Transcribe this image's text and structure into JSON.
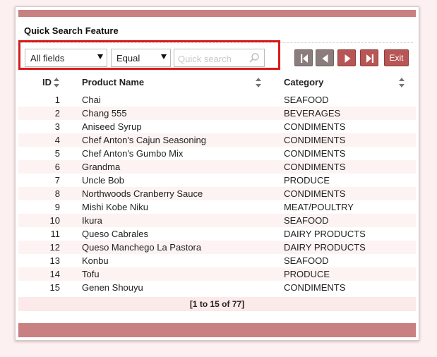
{
  "panel": {
    "title": "Quick Search Feature"
  },
  "search": {
    "field_select": "All fields",
    "operator_select": "Equal",
    "placeholder": "Quick search"
  },
  "nav": {
    "exit_label": "Exit"
  },
  "table": {
    "headers": {
      "id": "ID",
      "name": "Product Name",
      "category": "Category"
    },
    "rows": [
      {
        "id": "1",
        "name": "Chai",
        "category": "SEAFOOD"
      },
      {
        "id": "2",
        "name": "Chang 555",
        "category": "BEVERAGES"
      },
      {
        "id": "3",
        "name": "Aniseed Syrup",
        "category": "CONDIMENTS"
      },
      {
        "id": "4",
        "name": "Chef Anton's Cajun Seasoning",
        "category": "CONDIMENTS"
      },
      {
        "id": "5",
        "name": "Chef Anton's Gumbo Mix",
        "category": "CONDIMENTS"
      },
      {
        "id": "6",
        "name": "Grandma",
        "category": "CONDIMENTS"
      },
      {
        "id": "7",
        "name": "Uncle Bob",
        "category": "PRODUCE"
      },
      {
        "id": "8",
        "name": "Northwoods Cranberry Sauce",
        "category": "CONDIMENTS"
      },
      {
        "id": "9",
        "name": "Mishi Kobe Niku",
        "category": "MEAT/POULTRY"
      },
      {
        "id": "10",
        "name": "Ikura",
        "category": "SEAFOOD"
      },
      {
        "id": "11",
        "name": "Queso Cabrales",
        "category": "DAIRY PRODUCTS"
      },
      {
        "id": "12",
        "name": "Queso Manchego La Pastora",
        "category": "DAIRY PRODUCTS"
      },
      {
        "id": "13",
        "name": "Konbu",
        "category": "SEAFOOD"
      },
      {
        "id": "14",
        "name": "Tofu",
        "category": "PRODUCE"
      },
      {
        "id": "15",
        "name": "Genen Shouyu",
        "category": "CONDIMENTS"
      }
    ],
    "footer": "[1 to 15 of 77]"
  },
  "colors": {
    "accent_bar": "#c98080",
    "active_button": "#b85555",
    "inactive_button": "#8c7d7d",
    "highlight_border": "#d91a1a",
    "alt_row": "#fdf3f3",
    "page_bg": "#fdf0f0"
  },
  "icons": {
    "search": "magnifier-icon",
    "first": "first-page-icon",
    "prev": "prev-page-icon",
    "next": "next-page-icon",
    "last": "last-page-icon",
    "sort": "sort-arrows-icon",
    "dropdown": "chevron-down-icon"
  }
}
